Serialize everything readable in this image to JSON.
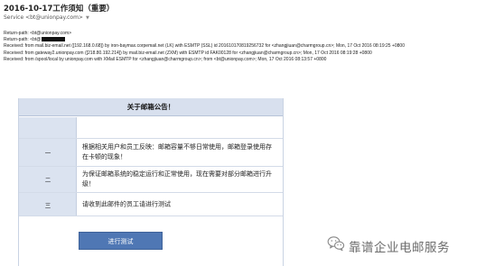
{
  "mail": {
    "subject": "2016-10-17工作须知（重要）",
    "sender": "Service <bt@unionpay.com>"
  },
  "raw_headers": [
    {
      "label": "Return-path:",
      "value": "<bt@unionpay.com>"
    },
    {
      "label": "Return-path:",
      "value": "<bt@"
    },
    {
      "label": "Received:",
      "value": "from mail.biz-email.net ([192.168.0.68])          by iron-baymax.corpemail.net (LK) with ESMTP (SSL) id 201610170819256732          for <zhangjiuan@charmgroup.cn>; Mon, 17 Oct 2016 08:19:25 +0800"
    },
    {
      "label": "Received:",
      "value": "from gateway2.unionpay.com ([218.80.192.214])          by mail.biz-email.net (ZXM) with ESMTP id FAK00128          for <zhangjiuan@charmgroup.cn>; Mon, 17 Oct 2016 08:19:28 +0800"
    },
    {
      "label": "Received:",
      "value": "from /spool/local by unionpay.com with XMail ESMTP          for <zhangjiuan@charmgroup.cn>; from <bt@unionpay.com>; Mon, 17 Oct 2016 08:13:57 +0800"
    }
  ],
  "notice": {
    "title": "关于邮箱公告！",
    "rows": [
      {
        "num": "",
        "text": ""
      },
      {
        "num": "一",
        "text": "根据相关用户和员工反映：邮箱容量不够日常使用，邮箱登录使用存在卡顿的现象！"
      },
      {
        "num": "二",
        "text": "为保证邮箱系统的稳定运行和正常使用，现在需要对部分邮箱进行升级！"
      },
      {
        "num": "三",
        "text": "请收到此邮件的员工请进行测试"
      }
    ],
    "button_label": "进行测试"
  },
  "watermark": {
    "text": "靠谱企业电邮服务",
    "icon": "wechat-icon"
  }
}
